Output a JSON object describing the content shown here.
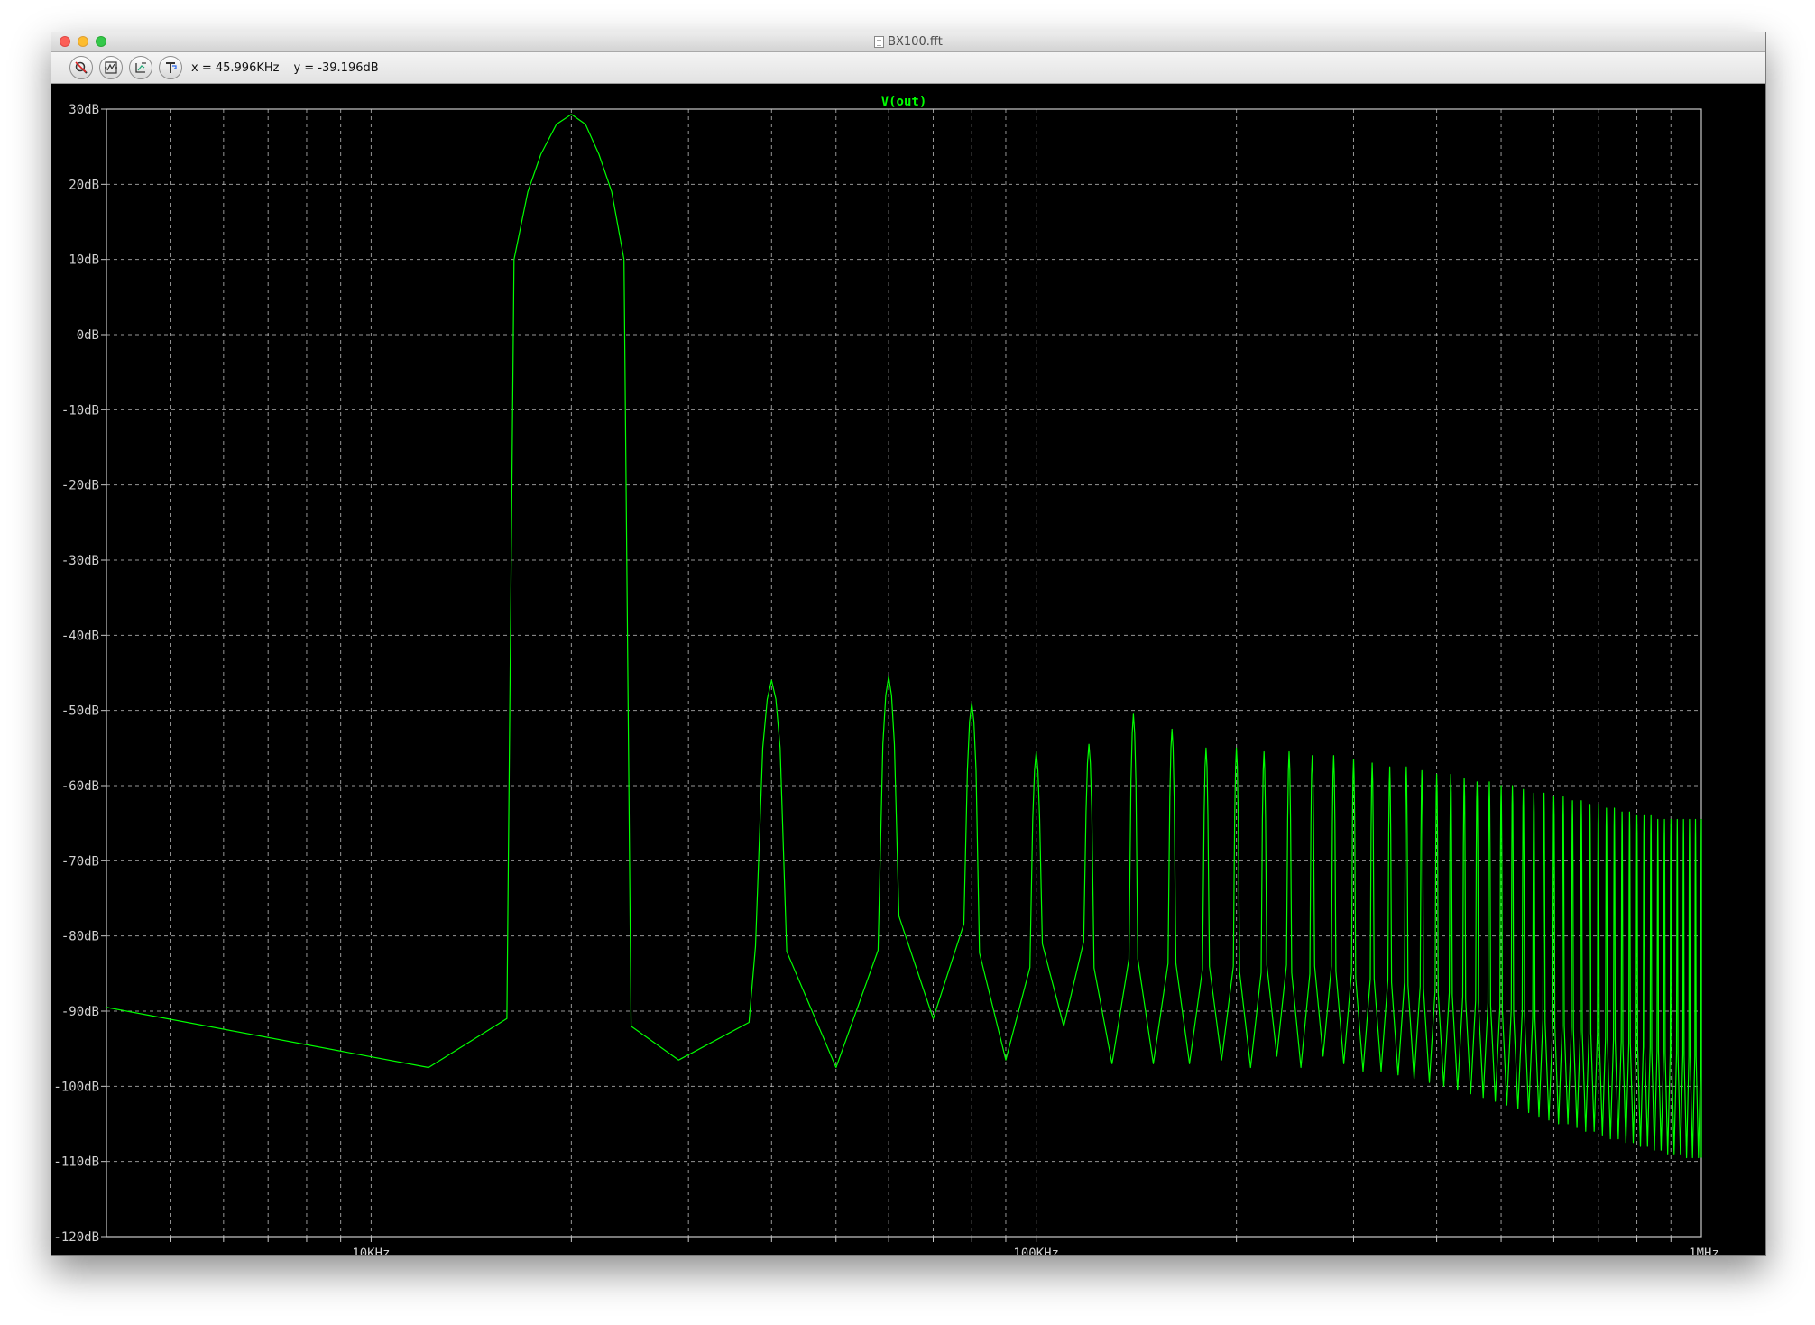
{
  "window": {
    "title": "BX100.fft"
  },
  "toolbar": {
    "buttons": [
      {
        "icon": "zoom-cancel-icon"
      },
      {
        "icon": "autorange-icon"
      },
      {
        "icon": "pan-icon"
      },
      {
        "icon": "label-cursor-icon"
      }
    ],
    "x_readout": "x = 45.996KHz",
    "y_readout": "y = -39.196dB"
  },
  "colors": {
    "trace": "#00ff00",
    "background": "#000000",
    "grid": "#c8c8c8",
    "axis_text": "#d0d0d0"
  },
  "chart_data": {
    "type": "line",
    "title": "V(out)",
    "x_scale": "log",
    "xlim": [
      4000,
      1000000
    ],
    "ylim": [
      -120,
      30
    ],
    "y_ticks": [
      30,
      20,
      10,
      0,
      -10,
      -20,
      -30,
      -40,
      -50,
      -60,
      -70,
      -80,
      -90,
      -100,
      -110,
      -120
    ],
    "y_tick_labels": [
      "30dB",
      "20dB",
      "10dB",
      "0dB",
      "-10dB",
      "-20dB",
      "-30dB",
      "-40dB",
      "-50dB",
      "-60dB",
      "-70dB",
      "-80dB",
      "-90dB",
      "-100dB",
      "-110dB",
      "-120dB"
    ],
    "x_ticks": [
      10000,
      100000,
      1000000
    ],
    "x_tick_labels": [
      "10KHz",
      "100KHz",
      "1MHz"
    ],
    "grid": true,
    "series": [
      {
        "name": "V(out)",
        "fundamental_hz": 20000,
        "harmonics_db": [
          29.3,
          -46,
          -45.5,
          -49,
          -55.5,
          -54.5,
          -50.5,
          -52.5,
          -55,
          -55,
          -55.5,
          -55.5,
          -56,
          -56,
          -56.5,
          -57,
          -57.5,
          -57.5,
          -58,
          -58.5,
          -58.5,
          -59,
          -59.5,
          -59.5,
          -60,
          -60,
          -60.5,
          -61,
          -61,
          -61.5,
          -61.5,
          -62,
          -62,
          -62.5,
          -62.5,
          -63,
          -63,
          -63.5,
          -63.5,
          -64,
          -64,
          -64,
          -64.5,
          -64.5,
          -64.5,
          -64.5,
          -64.5,
          -64.5,
          -64.5,
          -64.5
        ],
        "floor_db": [
          -89.5,
          -96.5,
          -97.5,
          -91,
          -96.5,
          -92,
          -97,
          -97,
          -97,
          -96.5,
          -97.5,
          -96,
          -97.5,
          -96,
          -97,
          -98,
          -98,
          -98.5,
          -99,
          -99.5,
          -100,
          -100.5,
          -101,
          -101.5,
          -102,
          -102.5,
          -103,
          -103.5,
          -104,
          -104.5,
          -105,
          -105,
          -105.5,
          -106,
          -106,
          -106.5,
          -107,
          -107,
          -107.5,
          -107.5,
          -108,
          -108,
          -108.5,
          -108.5,
          -109,
          -109,
          -109,
          -109.5,
          -109.5,
          -109.5
        ]
      }
    ]
  }
}
